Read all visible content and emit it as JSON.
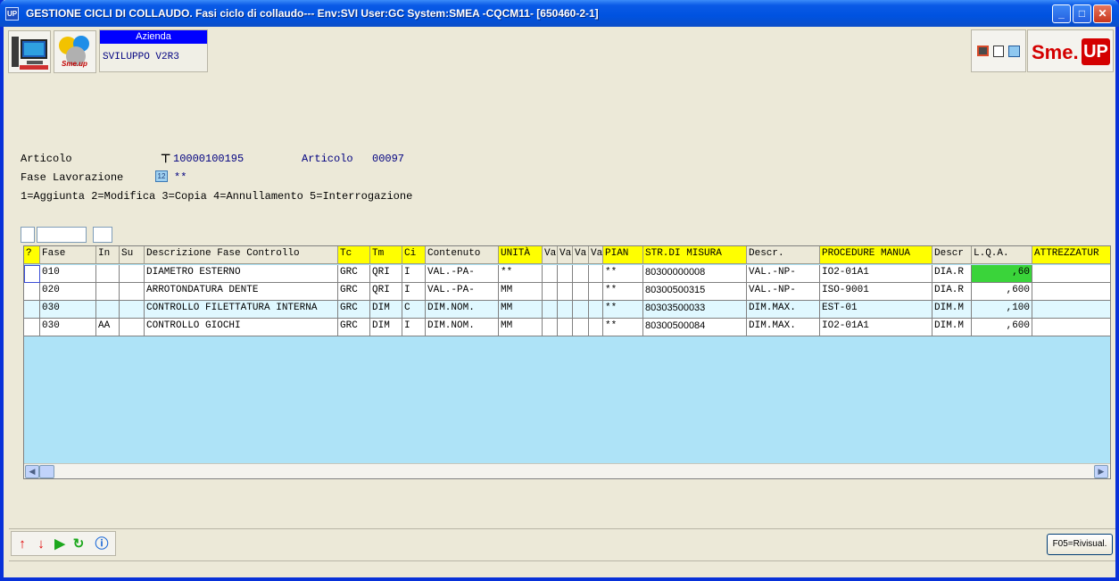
{
  "window": {
    "app_icon": "UP",
    "title": "GESTIONE CICLI DI COLLAUDO.  Fasi ciclo di collaudo--- Env:SVI User:GC System:SMEA -CQCM11- [650460-2-1]",
    "minimize": "_",
    "maximize": "□",
    "close": "✕"
  },
  "header": {
    "azienda_label": "Azienda",
    "azienda_value": "SVILUPPO V2R3",
    "logo_text": "Sme.up",
    "brand_sme": "Sme.",
    "brand_up": "UP"
  },
  "form": {
    "articolo_label": "Articolo",
    "articolo_value": "10000100195",
    "articolo2_label": "Articolo",
    "articolo2_value": "00097",
    "fase_label": "Fase Lavorazione",
    "fase_value": "**",
    "options": "1=Aggiunta  2=Modifica  3=Copia  4=Annullamento   5=Interrogazione"
  },
  "grid": {
    "headers": [
      "?",
      "Fase",
      "In",
      "Su",
      "Descrizione Fase Controllo",
      "Tc",
      "Tm",
      "Ci",
      "Contenuto",
      "UNITÀ",
      "Va",
      "Va",
      "Va",
      "Va",
      "PIAN",
      "STR.DI MISURA",
      "Descr.",
      "PROCEDURE MANUA",
      "Descr",
      "L.Q.A.",
      "ATTREZZATUR"
    ],
    "rows": [
      [
        "",
        "010",
        "",
        "",
        "DIAMETRO ESTERNO",
        "GRC",
        "QRI",
        "I",
        "VAL.-PA-",
        "**",
        "",
        "",
        "",
        "",
        "**",
        "80300000008",
        "VAL.-NP-",
        "IO2-01A1",
        "DIA.R",
        ",60",
        ""
      ],
      [
        "",
        "020",
        "",
        "",
        "ARROTONDATURA DENTE",
        "GRC",
        "QRI",
        "I",
        "VAL.-PA-",
        "MM",
        "",
        "",
        "",
        "",
        "**",
        "80300500315",
        "VAL.-NP-",
        "ISO-9001",
        "DIA.R",
        ",600",
        ""
      ],
      [
        "",
        "030",
        "",
        "",
        "CONTROLLO FILETTATURA INTERNA",
        "GRC",
        "DIM",
        "C",
        "DIM.NOM.",
        "MM",
        "",
        "",
        "",
        "",
        "**",
        "80303500033",
        "DIM.MAX.",
        "EST-01",
        "DIM.M",
        ",100",
        ""
      ],
      [
        "",
        "030",
        "AA",
        "",
        "CONTROLLO GIOCHI",
        "GRC",
        "DIM",
        "I",
        "DIM.NOM.",
        "MM",
        "",
        "",
        "",
        "",
        "**",
        "80300500084",
        "DIM.MAX.",
        "IO2-01A1",
        "DIM.M",
        ",600",
        ""
      ]
    ]
  },
  "footer": {
    "f05_label": "F05=Rivisual."
  },
  "colors": {
    "grid_background": "#aee3f7",
    "header_highlight": "#ffff00",
    "lqa_highlight": "#3ad43a",
    "title_bar": "#0052e0"
  }
}
